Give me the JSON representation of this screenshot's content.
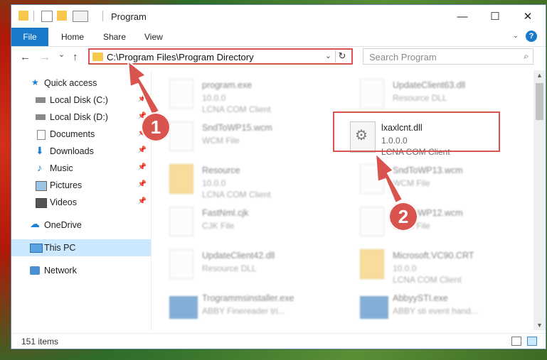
{
  "window": {
    "title": "Program",
    "controls": {
      "minimize": "—",
      "maximize": "☐",
      "close": "✕"
    }
  },
  "ribbon": {
    "tabs": [
      "File",
      "Home",
      "Share",
      "View"
    ],
    "help": "?"
  },
  "nav": {
    "back": "←",
    "forward": "→",
    "recent": "⌄",
    "up": "↑",
    "address": "C:\\Program Files\\Program Directory",
    "refresh": "↻",
    "search_placeholder": "Search Program"
  },
  "sidebar": {
    "items": [
      {
        "label": "Quick access",
        "icon": "star-icon",
        "pinned": false
      },
      {
        "label": "Local Disk (C:)",
        "icon": "drive-icon",
        "pinned": true
      },
      {
        "label": "Local Disk (D:)",
        "icon": "drive-icon",
        "pinned": true
      },
      {
        "label": "Documents",
        "icon": "documents-icon",
        "pinned": true
      },
      {
        "label": "Downloads",
        "icon": "downloads-icon",
        "pinned": true
      },
      {
        "label": "Music",
        "icon": "music-icon",
        "pinned": true
      },
      {
        "label": "Pictures",
        "icon": "pictures-icon",
        "pinned": true
      },
      {
        "label": "Videos",
        "icon": "videos-icon",
        "pinned": true
      },
      {
        "label": "OneDrive",
        "icon": "cloud-icon",
        "pinned": false
      },
      {
        "label": "This PC",
        "icon": "computer-icon",
        "pinned": false,
        "selected": true
      },
      {
        "label": "Network",
        "icon": "network-icon",
        "pinned": false
      }
    ]
  },
  "files": [
    {
      "name": "program.exe",
      "line2": "10.0.0",
      "line3": "LCNA COM Client",
      "icon": "exe-icon",
      "blurred": true
    },
    {
      "name": "UpdateClient63.dll",
      "line2": "Resource DLL",
      "line3": "",
      "icon": "dll-icon",
      "blurred": true
    },
    {
      "name": "SndToWP15.wcm",
      "line2": "WCM File",
      "line3": "",
      "icon": "file-icon",
      "blurred": true
    },
    {
      "name": "lxaxlcnt.dll",
      "line2": "1.0.0.0",
      "line3": "LCNA COM Client",
      "icon": "dll-gear-icon",
      "blurred": false,
      "highlighted": true
    },
    {
      "name": "Resource",
      "line2": "10.0.0",
      "line3": "LCNA COM Client",
      "icon": "folder-icon",
      "blurred": true
    },
    {
      "name": "SndToWP13.wcm",
      "line2": "WCM File",
      "line3": "",
      "icon": "file-icon",
      "blurred": true
    },
    {
      "name": "FastNml.cjk",
      "line2": "CJK File",
      "line3": "",
      "icon": "file-icon",
      "blurred": true
    },
    {
      "name": "SndToWP12.wcm",
      "line2": "WCM File",
      "line3": "",
      "icon": "file-icon",
      "blurred": true
    },
    {
      "name": "UpdateClient42.dll",
      "line2": "Resource DLL",
      "line3": "",
      "icon": "dll-icon",
      "blurred": true
    },
    {
      "name": "Microsoft.VC90.CRT",
      "line2": "10.0.0",
      "line3": "LCNA COM Client",
      "icon": "folder-icon",
      "blurred": true
    },
    {
      "name": "Trogrammsinstaller.exe",
      "line2": "ABBY Finereader tri...",
      "line3": "",
      "icon": "app-icon",
      "blurred": true
    },
    {
      "name": "AbbyySTI.exe",
      "line2": "ABBY sti event hand...",
      "line3": "",
      "icon": "app-icon",
      "blurred": true
    }
  ],
  "status": {
    "count": "151 items"
  },
  "annotations": {
    "step1": "1",
    "step2": "2",
    "accent": "#d9534f"
  }
}
